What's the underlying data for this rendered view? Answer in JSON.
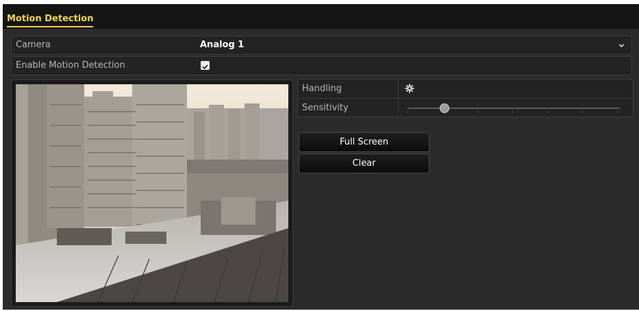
{
  "header": {
    "title": "Motion Detection"
  },
  "camera": {
    "label": "Camera",
    "value": "Analog 1"
  },
  "enable_motion": {
    "label": "Enable Motion Detection",
    "checked": true
  },
  "handling": {
    "label": "Handling",
    "icon": "gear-icon"
  },
  "sensitivity": {
    "label": "Sensitivity",
    "level": 0.17
  },
  "buttons": {
    "full_screen": "Full Screen",
    "clear": "Clear"
  },
  "colors": {
    "accent": "#f2d74a",
    "panel": "#2b2b2b",
    "titlebar": "#151515"
  }
}
